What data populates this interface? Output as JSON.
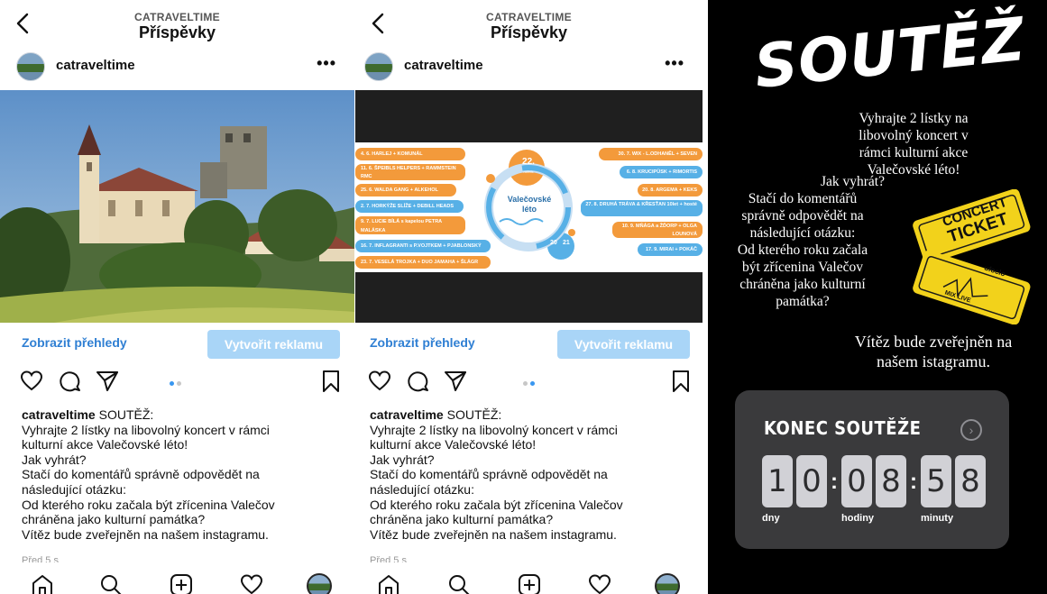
{
  "posts": [
    {
      "header": {
        "account": "CATRAVELTIME",
        "title": "Příspěvky"
      },
      "username": "catraveltime",
      "insights_label": "Zobrazit přehledy",
      "promote_label": "Vytvořit reklamu",
      "caption_user": "catraveltime",
      "caption_lines": [
        " SOUTĚŽ:",
        "Vyhrajte 2 lístky na libovolný koncert v rámci",
        "kulturní akce Valečovské léto!",
        "Jak vyhrát?",
        "Stačí do komentářů správně odpovědět na",
        "následující otázku:",
        "Od kterého roku začala být zřícenina Valečov",
        "chráněna jako kulturní památka?",
        "Vítěz bude zveřejněn na našem instagramu."
      ],
      "date": "Před 5 s",
      "carousel": {
        "count": 2,
        "active": 1
      }
    },
    {
      "header": {
        "account": "CATRAVELTIME",
        "title": "Příspěvky"
      },
      "username": "catraveltime",
      "insights_label": "Zobrazit přehledy",
      "promote_label": "Vytvořit reklamu",
      "caption_user": "catraveltime",
      "caption_lines": [
        " SOUTĚŽ:",
        "Vyhrajte 2 lístky na libovolný koncert v rámci",
        "kulturní akce Valečovské léto!",
        "Jak vyhrát?",
        "Stačí do komentářů správně odpovědět na",
        "následující otázku:",
        "Od kterého roku začala být zřícenina Valečov",
        "chráněna jako kulturní památka?",
        "Vítěz bude zveřejněn na našem instagramu."
      ],
      "date": "Před 5 s",
      "carousel": {
        "count": 2,
        "active": 2
      },
      "festival": {
        "title": "Valečovské léto",
        "badge_number": "22.",
        "badge_sub": "ročník",
        "year_left": "20",
        "year_right": "21",
        "left": [
          "4. 6.  HARLEJ + KOMUNÁL",
          "11. 6.  ŠPEIBLS HELPERS + RAMMSTEIN RMC",
          "25. 6.  WALDA GANG + ALKEHOL",
          "2. 7.  HORKÝŽE SLÍŽE + DEBILL HEADS",
          "9. 7.  LUCIE BÍLÁ s kapelou PETRA MALÁSKA",
          "16. 7.  INFLAGRANTI s P.VOJTKEM + PJABLONSKÝ",
          "23. 7.  VESELÁ TROJKA + DUO JAMAHA + ŠLÁGR"
        ],
        "right": [
          "30. 7.  WIX - L.ODHANĚL + SEVEN",
          "6. 8.  KRUCIPÜSK + RIMORTIS",
          "20. 8.  ARGEMA + KEKS",
          "27. 8.  DRUHÁ TRÁVA & KŘESŤAN 10let + hosté",
          "10. 9.  MŇÁGA a ŽĎORP + OLGA LOUNOVÁ",
          "17. 9.  MIRAI + POKÁČ"
        ]
      }
    }
  ],
  "story": {
    "title": "SOUTĚŽ",
    "intro_lines": [
      "Vyhrajte 2 lístky na",
      "libovolný koncert v",
      "rámci kulturní akce",
      "Valečovské léto!"
    ],
    "question_lines": [
      "Jak vyhrát?",
      "Stačí do komentářů",
      "správně odpovědět na",
      "následující otázku:",
      "Od kterého roku začala",
      "být zřícenina Valečov",
      "chráněna jako kulturní",
      "památka?"
    ],
    "winner_lines": [
      "Vítěz bude zveřejněn na",
      "našem istagramu."
    ],
    "ticket": {
      "line1": "CONCERT",
      "line2": "TICKET",
      "brand": "ufoclo",
      "mix": "MIX LIVE"
    },
    "countdown": {
      "title": "KONEC SOUTĚŽE",
      "digits": [
        "1",
        "0",
        "0",
        "8",
        "5",
        "8"
      ],
      "units": [
        "dny",
        "hodiny",
        "minuty"
      ]
    }
  },
  "colors": {
    "link_blue": "#2f7fd3",
    "promote_bg": "#a9d5f7",
    "festival_orange": "#f39a3b",
    "festival_blue": "#57b0e6",
    "story_bg": "#000000",
    "countdown_bg": "#3a3a3c",
    "ticket_yellow": "#f2d21b"
  },
  "icons": [
    "back-chevron-icon",
    "more-dots-icon",
    "heart-icon",
    "comment-icon",
    "share-icon",
    "bookmark-icon",
    "home-icon",
    "search-icon",
    "new-post-icon",
    "activity-heart-icon",
    "profile-avatar-icon",
    "chevron-right-circle-icon"
  ]
}
